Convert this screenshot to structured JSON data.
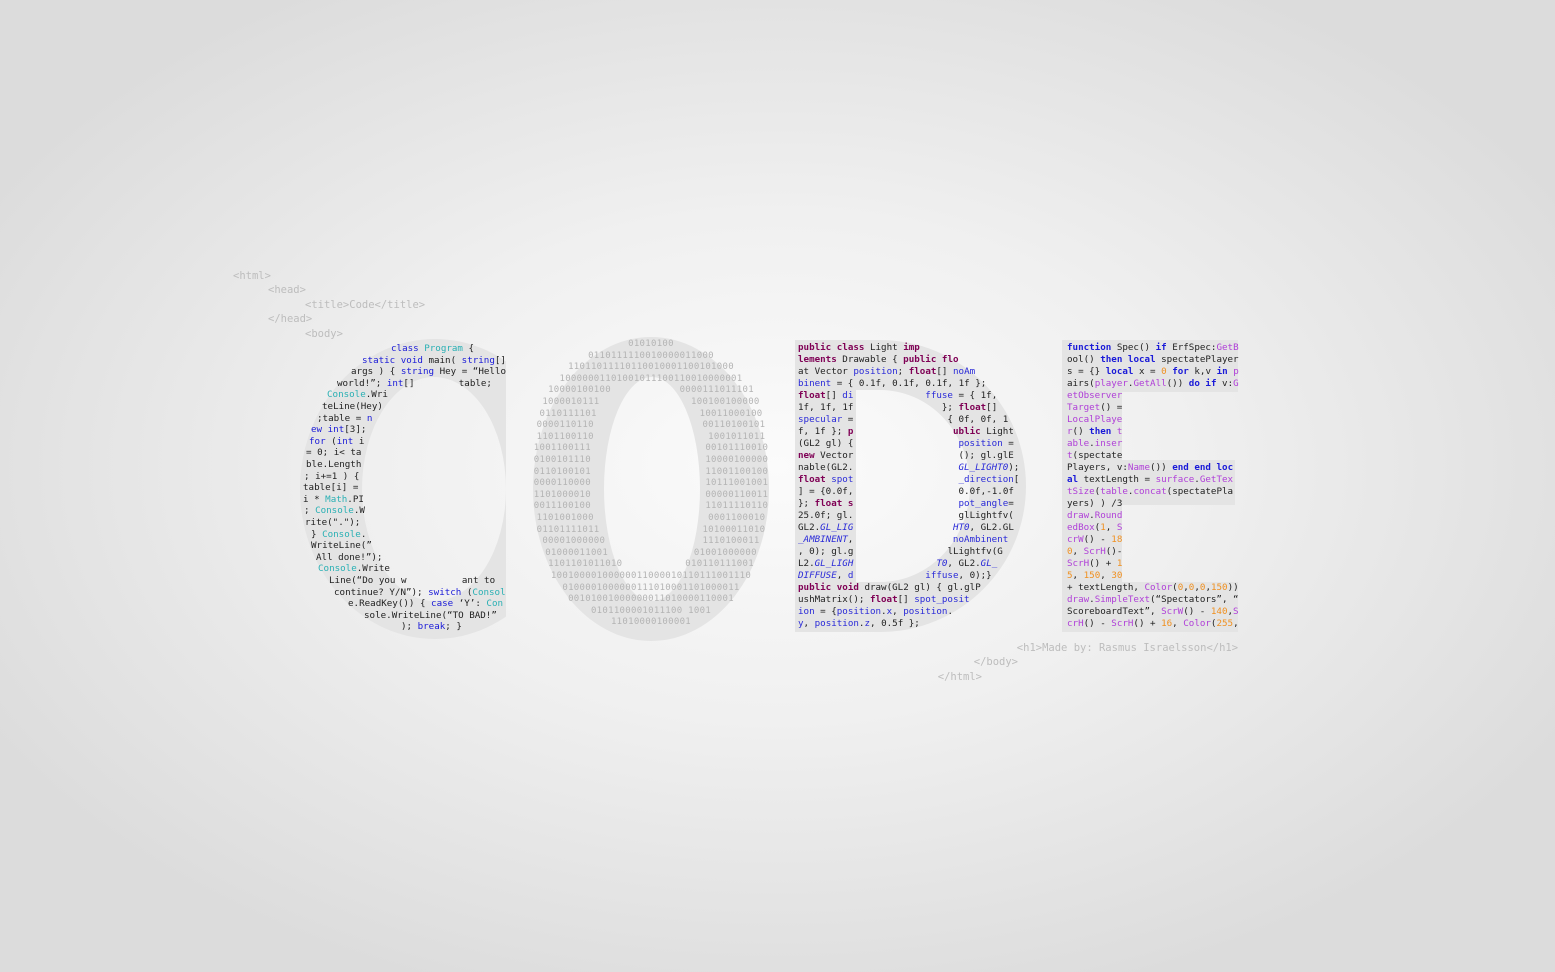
{
  "colors": {
    "letter_fill": "#e4e4e4",
    "tag_text": "#bdbdbd",
    "code_text": "#222222",
    "binary_text": "#b4b4b4"
  },
  "html_tags_top": [
    "<html>",
    "<head>",
    "<title>Code</title>",
    "</head>",
    "<body>"
  ],
  "html_tags_bottom": [
    "<h1>Made by: Rasmus Israelsson</h1>",
    "</body>",
    "</html>"
  ],
  "c_block": {
    "language": "C#",
    "keyword_color": "#1a1ad8",
    "type_color": "#2ab0b4",
    "keywords": [
      "class",
      "static",
      "void",
      "string",
      "int",
      "for",
      "switch",
      "case",
      "break",
      "n",
      "ew"
    ],
    "types": [
      "Program",
      "Console",
      "Math",
      "Consol",
      "Con"
    ],
    "lines": [
      "class Program {",
      "static void main( string[]",
      "args ) { string Hey = “Hello",
      "world!”; int[]        table;",
      "Console.Wri",
      "teLine(Hey)",
      ";table = n",
      "ew int[3];",
      "for (int i",
      "= 0; i< ta",
      "ble.Length",
      "; i+=1 ) {",
      "table[i] =",
      "i * Math.PI",
      "; Console.W",
      "rite(\".\");",
      "} Console.",
      "WriteLine(”",
      "All done!”);",
      "Console.Write",
      "Line(“Do you w          ant to",
      "continue? Y/N”); switch (Consol",
      "e.ReadKey()) { case ‘Y’: Con",
      "sole.WriteLine(“TO BAD!”",
      "); break; }"
    ]
  },
  "o_block": {
    "lines": [
      "01010100",
      "0110111110010000011000",
      "11011011110110010001100101000",
      "10000001101001011100110010000001",
      "10000100100            0000111011101",
      "1000010111                100100100000",
      "0110111101                  10011000100",
      "0000110110                   00110100101",
      "1101100110                    1001011011",
      "1001100111                    00101110010",
      "0100101110                    10000100000",
      "0110100101                    11001100100",
      "0000110000                    10111001001",
      "1101000010                    00000110011",
      "0011100100                    11011110110",
      "1101001000                    0001100010",
      "01101111011                  10100011010",
      "00001000000                 1110100011",
      "01000011001               01001000000",
      "1101101011010           010110111001",
      "10010000100000011000010110111001110",
      "0100001000000111010001101000011",
      "00101001000000011010000110001",
      "0101100001011100 1001",
      "11010000100001"
    ]
  },
  "d_block": {
    "language": "Java",
    "keyword_color": "#7f0055",
    "field_color": "#2a2ad8",
    "keywords": [
      "public",
      "class",
      "imp",
      "lements",
      "flo",
      "float",
      "new",
      "void",
      "p",
      "ublic",
      "s"
    ],
    "fields": [
      "position",
      "noAm",
      "binent",
      "di",
      "ffuse",
      "specular",
      "spot",
      "_direction",
      "pot_angle",
      "GL_LIG",
      "HT0",
      "_AMBINENT",
      "noAmbinent",
      "GL_LIGH",
      "T0",
      "GL_",
      "DIFFUSE",
      "d",
      "iffuse",
      "GL_LIGHT0",
      "spot_posit",
      "ion",
      "x",
      "y",
      "z"
    ],
    "rows": [
      [
        "public class Light imp",
        ""
      ],
      [
        "lements Drawable { public flo",
        ""
      ],
      [
        "at Vector position; float[] noAm",
        ""
      ],
      [
        "binent = { 0.1f, 0.1f, 0.1f, 1f };",
        ""
      ],
      [
        "float[] di",
        "ffuse = { 1f,"
      ],
      [
        "1f, 1f, 1f",
        "}; float[]"
      ],
      [
        "specular =",
        "{ 0f, 0f, 1"
      ],
      [
        "f, 1f }; p",
        "ublic Light"
      ],
      [
        "(GL2 gl) {",
        "position ="
      ],
      [
        "new Vector",
        "(); gl.glE"
      ],
      [
        "nable(GL2.",
        "GL_LIGHT0);"
      ],
      [
        "float spot",
        "_direction["
      ],
      [
        "] = {0.0f,",
        "0.0f,-1.0f"
      ],
      [
        "}; float s",
        "pot_angle="
      ],
      [
        "25.0f; gl.",
        "glLightfv("
      ],
      [
        "GL2.GL_LIG",
        "HT0, GL2.GL"
      ],
      [
        "_AMBINENT,",
        "noAmbinent"
      ],
      [
        ", 0); gl.g",
        "lLightfv(G"
      ],
      [
        "L2.GL_LIGH",
        "T0, GL2.GL_"
      ],
      [
        "DIFFUSE, d",
        "iffuse, 0);}"
      ],
      [
        "public void draw(GL2 gl) { gl.glP",
        ""
      ],
      [
        "ushMatrix(); float[] spot_posit",
        ""
      ],
      [
        "ion = {position.x, position.",
        ""
      ],
      [
        "y, position.z, 0.5f };",
        ""
      ]
    ]
  },
  "e_block": {
    "language": "Lua",
    "keyword_color": "#1a1ad8",
    "func_color": "#b040d8",
    "number_color": "#f09020",
    "string_color": "#808080",
    "keywords": [
      "function",
      "if",
      "then",
      "local",
      "for",
      "in",
      "do",
      "end",
      "loc",
      "al"
    ],
    "funcs": [
      "GetB",
      "player",
      "GetAll",
      "surface",
      "GetTex",
      "tSize",
      "table",
      "concat",
      "draw",
      "Round",
      "edBox",
      "SimpleText",
      "ScrW",
      "crW",
      "ScrH",
      "crH",
      "Color",
      "LocalPlaye",
      "r",
      "t",
      "able",
      "inser",
      "etObserver",
      "Target",
      "Name",
      "S",
      "G",
      "p"
    ],
    "lines": [
      "function Spec() if ErfSpec:GetB",
      "ool() then local spectatePlayer",
      "s = {} local x = 0 for k,v in p",
      "airs(player.GetAll()) do if v:G",
      "etObserver",
      "Target() =",
      "LocalPlaye",
      "r() then t",
      "able.inser",
      "t(spectate",
      "Players, v:Name()) end end loc",
      "al textLength = surface.GetTex",
      "tSize(table.concat(spectatePla",
      "yers) ) /3",
      "draw.Round",
      "edBox(1, S",
      "crW() - 18",
      "0, ScrH()-",
      "ScrH() + 1",
      "5, 150, 30",
      "+ textLength, Color(0,0,0,150))",
      "draw.SimpleText(“Spectators”, “",
      "ScoreboardText”, ScrW() - 140,S",
      "crH() - ScrH() + 16, Color(255,"
    ]
  }
}
